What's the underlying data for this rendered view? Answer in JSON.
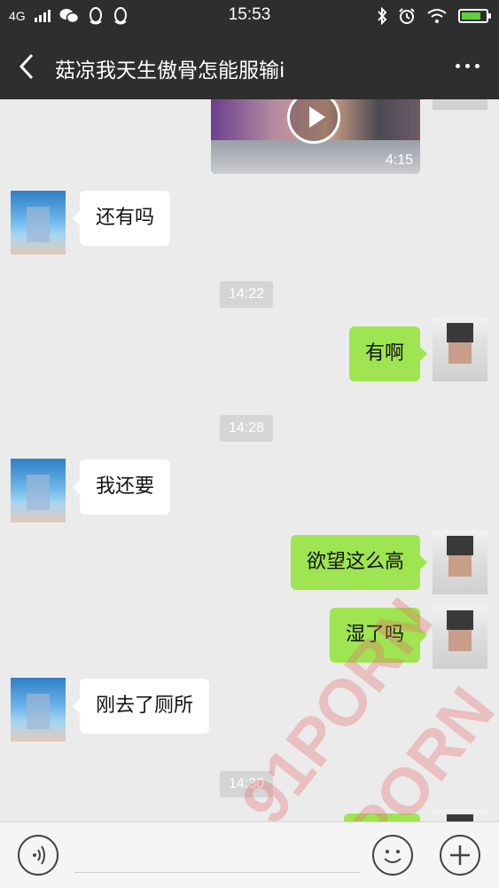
{
  "status_bar": {
    "network": "4G",
    "time": "15:53"
  },
  "nav": {
    "title": "菇凉我天生傲骨怎能服输i"
  },
  "messages": [
    {
      "type": "video",
      "side": "out",
      "duration": "4:15"
    },
    {
      "type": "text",
      "side": "in",
      "text": "还有吗"
    },
    {
      "type": "time",
      "text": "14:22"
    },
    {
      "type": "text",
      "side": "out",
      "text": "有啊"
    },
    {
      "type": "time",
      "text": "14:28"
    },
    {
      "type": "text",
      "side": "in",
      "text": "我还要"
    },
    {
      "type": "text",
      "side": "out",
      "text": "欲望这么高"
    },
    {
      "type": "text",
      "side": "out",
      "text": "湿了吗"
    },
    {
      "type": "text",
      "side": "in",
      "text": "刚去了厕所"
    },
    {
      "type": "time",
      "text": "14:30"
    }
  ],
  "watermark": {
    "text": "91PORN"
  },
  "icons": {
    "back": "chevron-left-icon",
    "more": "more-dots-icon",
    "voice": "voice-icon",
    "emoji": "emoji-icon",
    "plus": "plus-icon"
  },
  "colors": {
    "header_bg": "#2e2e2e",
    "chat_bg": "#ebebeb",
    "outgoing_bubble": "#9ee551",
    "incoming_bubble": "#ffffff",
    "time_label_bg": "#d5d5d5",
    "battery_fill": "#5fd03a"
  }
}
